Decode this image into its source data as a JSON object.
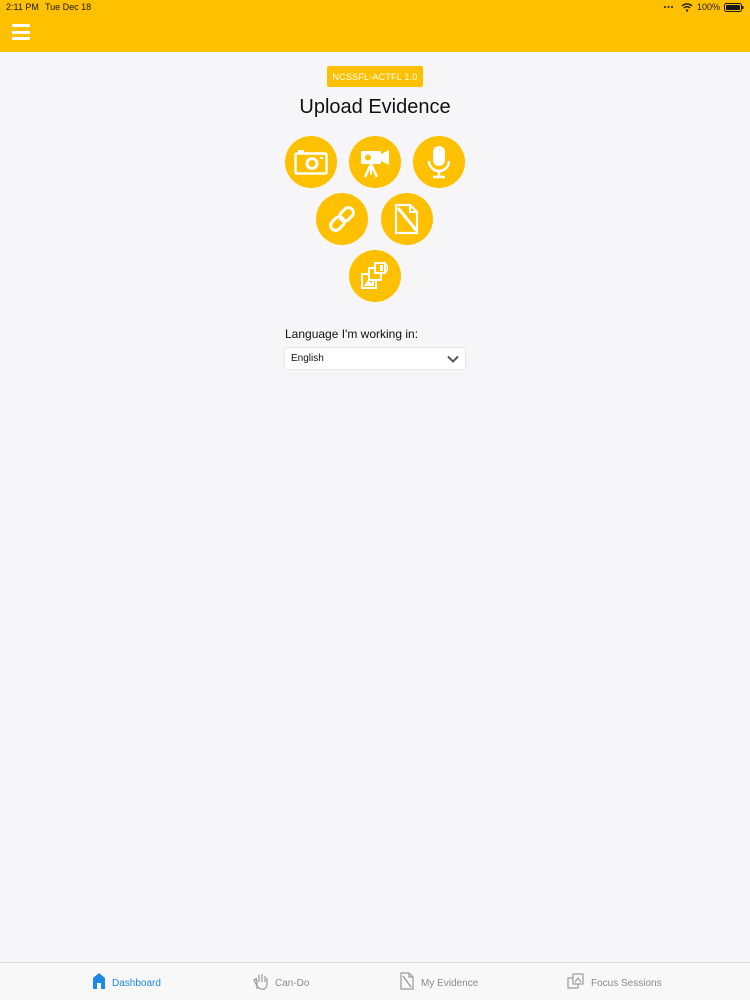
{
  "status_bar": {
    "time": "2:11 PM",
    "date": "Tue Dec 18",
    "battery": "100%"
  },
  "header": {
    "menu_icon": "hamburger-icon",
    "color": "#ffc000"
  },
  "main": {
    "version_badge": "NCSSFL-ACTFL 1.0",
    "title": "Upload Evidence",
    "upload_options": [
      {
        "icon": "camera-icon"
      },
      {
        "icon": "video-camera-icon"
      },
      {
        "icon": "microphone-icon"
      },
      {
        "icon": "link-icon"
      },
      {
        "icon": "edit-document-icon"
      },
      {
        "icon": "media-gallery-icon"
      }
    ],
    "language_label": "Language I'm working in:",
    "language_value": "English"
  },
  "tabs": [
    {
      "label": "Dashboard",
      "icon": "home-icon",
      "active": true
    },
    {
      "label": "Can-Do",
      "icon": "hand-icon",
      "active": false
    },
    {
      "label": "My Evidence",
      "icon": "document-icon",
      "active": false
    },
    {
      "label": "Focus Sessions",
      "icon": "focus-icon",
      "active": false
    }
  ],
  "colors": {
    "accent": "#ffc000",
    "active_tab": "#1e88e5",
    "inactive_tab": "#8a8a8a"
  }
}
